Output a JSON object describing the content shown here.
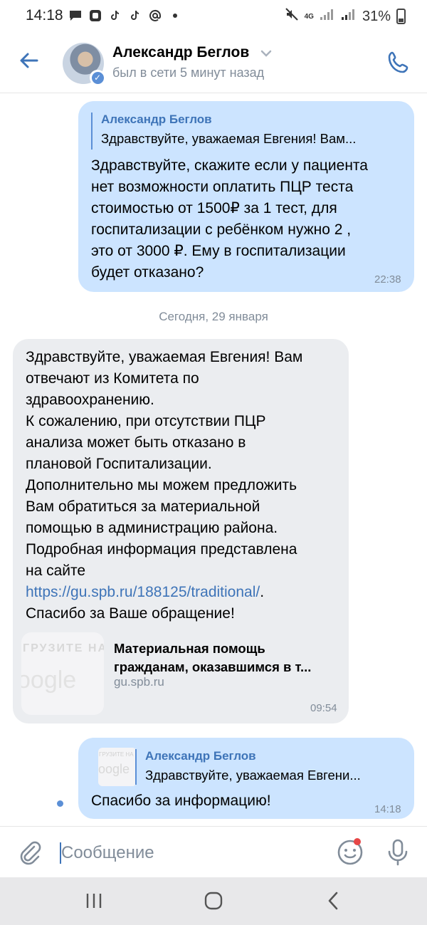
{
  "status_bar": {
    "time": "14:18",
    "network": "4G",
    "battery": "31%"
  },
  "header": {
    "name": "Александр Беглов",
    "last_seen": "был в сети 5 минут назад"
  },
  "messages": {
    "m1": {
      "reply_name": "Александр Беглов",
      "reply_text": "Здравствуйте, уважаемая Евгения! Вам...",
      "lines": [
        "Здравствуйте, скажите если у пациента",
        "нет возможности оплатить ПЦР теста",
        "стоимостью от 1500₽ за 1 тест, для",
        "госпитализации с ребёнком нужно 2 ,",
        "это от 3000 ₽. Ему в госпитализации",
        "будет отказано?"
      ],
      "time": "22:38"
    },
    "date_separator": "Сегодня, 29 января",
    "m2": {
      "lines": [
        "Здравствуйте, уважаемая Евгения! Вам",
        "отвечают из Комитета по",
        "здравоохранению.",
        "К сожалению, при отсутствии ПЦР",
        "анализа может быть отказано в",
        "плановой Госпитализации.",
        "Дополнительно мы можем предложить",
        "Вам обратиться за материальной",
        "помощью в администрацию района.",
        "Подробная информация представлена",
        "на сайте"
      ],
      "link": "https://gu.spb.ru/188125/traditional/",
      "link_suffix": ".",
      "last_line": "Спасибо за Ваше обращение!",
      "card": {
        "title": "Материальная помощь гражданам, оказавшимся в т...",
        "domain": "gu.spb.ru",
        "thumb_text_1": "ГРУЗИТЕ НА",
        "thumb_text_2": "oogle"
      },
      "time": "09:54"
    },
    "m3": {
      "reply_name": "Александр Беглов",
      "reply_text": "Здравствуйте, уважаемая Евгени...",
      "text": "Спасибо за информацию!",
      "time": "14:18"
    }
  },
  "composer": {
    "placeholder": "Сообщение"
  },
  "colors": {
    "accent": "#3e74b8",
    "outgoing_bubble": "#cce4ff",
    "incoming_bubble": "#ebedf0",
    "secondary_text": "#818c99"
  },
  "icons": [
    "back-arrow-icon",
    "verified-icon",
    "chevron-down-icon",
    "phone-icon",
    "paperclip-icon",
    "emoji-icon",
    "microphone-icon",
    "recent-apps-icon",
    "home-icon",
    "nav-back-icon"
  ]
}
